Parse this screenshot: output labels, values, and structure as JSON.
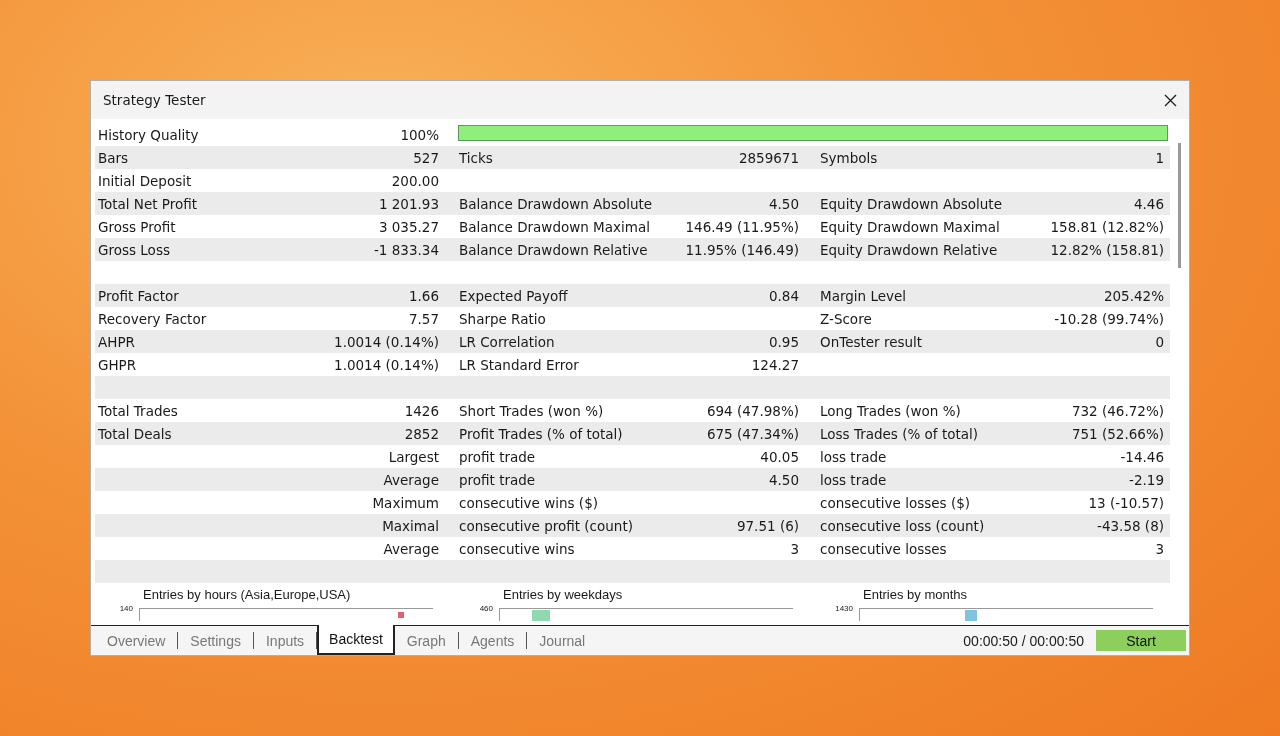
{
  "window": {
    "title": "Strategy Tester"
  },
  "rows": [
    {
      "kind": "bar",
      "level": 1,
      "cells": [
        {
          "label": "History Quality",
          "value": "100%"
        }
      ]
    },
    {
      "kind": "stat",
      "cells": [
        {
          "label": "Bars",
          "value": "527"
        },
        {
          "label": "Ticks",
          "value": "2859671"
        },
        {
          "label": "Symbols",
          "value": "1"
        }
      ]
    },
    {
      "kind": "stat",
      "cells": [
        {
          "label": "Initial Deposit",
          "value": "200.00"
        }
      ]
    },
    {
      "kind": "stat",
      "cells": [
        {
          "label": "Total Net Profit",
          "value": "1 201.93"
        },
        {
          "label": "Balance Drawdown Absolute",
          "value": "4.50"
        },
        {
          "label": "Equity Drawdown Absolute",
          "value": "4.46"
        }
      ]
    },
    {
      "kind": "stat",
      "cells": [
        {
          "label": "Gross Profit",
          "value": "3 035.27"
        },
        {
          "label": "Balance Drawdown Maximal",
          "value": "146.49 (11.95%)"
        },
        {
          "label": "Equity Drawdown Maximal",
          "value": "158.81 (12.82%)"
        }
      ]
    },
    {
      "kind": "stat",
      "cells": [
        {
          "label": "Gross Loss",
          "value": "-1 833.34"
        },
        {
          "label": "Balance Drawdown Relative",
          "value": "11.95% (146.49)"
        },
        {
          "label": "Equity Drawdown Relative",
          "value": "12.82% (158.81)"
        }
      ]
    },
    {
      "kind": "blank"
    },
    {
      "kind": "stat",
      "cells": [
        {
          "label": "Profit Factor",
          "value": "1.66"
        },
        {
          "label": "Expected Payoff",
          "value": "0.84"
        },
        {
          "label": "Margin Level",
          "value": "205.42%"
        }
      ]
    },
    {
      "kind": "stat",
      "cells": [
        {
          "label": "Recovery Factor",
          "value": "7.57"
        },
        {
          "label": "Sharpe Ratio"
        },
        {
          "label": "Z-Score",
          "value": "-10.28 (99.74%)"
        }
      ]
    },
    {
      "kind": "stat",
      "cells": [
        {
          "label": "AHPR",
          "value": "1.0014 (0.14%)"
        },
        {
          "label": "LR Correlation",
          "value": "0.95"
        },
        {
          "label": "OnTester result",
          "value": "0"
        }
      ]
    },
    {
      "kind": "stat",
      "cells": [
        {
          "label": "GHPR",
          "value": "1.0014 (0.14%)"
        },
        {
          "label": "LR Standard Error",
          "value": "124.27"
        }
      ]
    },
    {
      "kind": "blank"
    },
    {
      "kind": "stat",
      "cells": [
        {
          "label": "Total Trades",
          "value": "1426"
        },
        {
          "label": "Short Trades (won %)",
          "value": "694 (47.98%)"
        },
        {
          "label": "Long Trades (won %)",
          "value": "732 (46.72%)"
        }
      ]
    },
    {
      "kind": "stat",
      "cells": [
        {
          "label": "Total Deals",
          "value": "2852"
        },
        {
          "label": "Profit Trades (% of total)",
          "value": "675 (47.34%)"
        },
        {
          "label": "Loss Trades (% of total)",
          "value": "751 (52.66%)"
        }
      ]
    },
    {
      "kind": "sub",
      "cells": [
        {
          "label": "Largest"
        },
        {
          "label": "profit trade",
          "value": "40.05"
        },
        {
          "label": "loss trade",
          "value": "-14.46"
        }
      ]
    },
    {
      "kind": "sub",
      "cells": [
        {
          "label": "Average"
        },
        {
          "label": "profit trade",
          "value": "4.50"
        },
        {
          "label": "loss trade",
          "value": "-2.19"
        }
      ]
    },
    {
      "kind": "sub",
      "cells": [
        {
          "label": "Maximum"
        },
        {
          "label": "consecutive wins ($)"
        },
        {
          "label": "consecutive losses ($)",
          "value": "13 (-10.57)"
        }
      ]
    },
    {
      "kind": "sub",
      "cells": [
        {
          "label": "Maximal"
        },
        {
          "label": "consecutive profit (count)",
          "value": "97.51 (6)"
        },
        {
          "label": "consecutive loss (count)",
          "value": "-43.58 (8)"
        }
      ]
    },
    {
      "kind": "sub",
      "cells": [
        {
          "label": "Average"
        },
        {
          "label": "consecutive wins",
          "value": "3"
        },
        {
          "label": "consecutive losses",
          "value": "3"
        }
      ]
    },
    {
      "kind": "blank"
    }
  ],
  "charts": [
    {
      "title": "Entries by hours (Asia,Europe,USA)",
      "tick": "140",
      "color": "#e06070"
    },
    {
      "title": "Entries by weekdays",
      "tick": "460",
      "color": "#8fd8b0"
    },
    {
      "title": "Entries by months",
      "tick": "1430",
      "color": "#7ec4e0"
    }
  ],
  "tabs": [
    {
      "label": "Overview",
      "selected": false
    },
    {
      "label": "Settings",
      "selected": false
    },
    {
      "label": "Inputs",
      "selected": false
    },
    {
      "label": "Backtest",
      "selected": true
    },
    {
      "label": "Graph",
      "selected": false
    },
    {
      "label": "Agents",
      "selected": false
    },
    {
      "label": "Journal",
      "selected": false
    }
  ],
  "elapsed": "00:00:50 / 00:00:50",
  "start_button": "Start"
}
